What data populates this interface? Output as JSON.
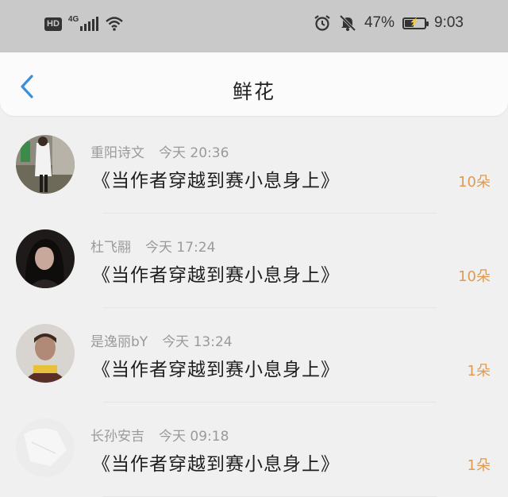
{
  "status_bar": {
    "hd_label": "HD",
    "network_label": "4G",
    "battery_text": "47%",
    "battery_level": 47,
    "time": "9:03",
    "icons": [
      "hd-icon",
      "signal-icon",
      "wifi-icon",
      "alarm-icon",
      "mute-icon",
      "battery-icon"
    ]
  },
  "header": {
    "title": "鲜花",
    "back_icon": "chevron-left-icon",
    "accent_color": "#3b8fd9"
  },
  "list": {
    "items": [
      {
        "user": "重阳诗文",
        "time": "今天 20:36",
        "book": "《当作者穿越到赛小息身上》",
        "quantity": "10朵"
      },
      {
        "user": "杜飞翮",
        "time": "今天 17:24",
        "book": "《当作者穿越到赛小息身上》",
        "quantity": "10朵"
      },
      {
        "user": "是逸丽bY",
        "time": "今天 13:24",
        "book": "《当作者穿越到赛小息身上》",
        "quantity": "1朵"
      },
      {
        "user": "长孙安吉",
        "time": "今天 09:18",
        "book": "《当作者穿越到赛小息身上》",
        "quantity": "1朵"
      }
    ]
  },
  "colors": {
    "status_bar_bg": "#c9c9c9",
    "page_bg": "#f0f0f0",
    "quantity": "#e09a50"
  }
}
